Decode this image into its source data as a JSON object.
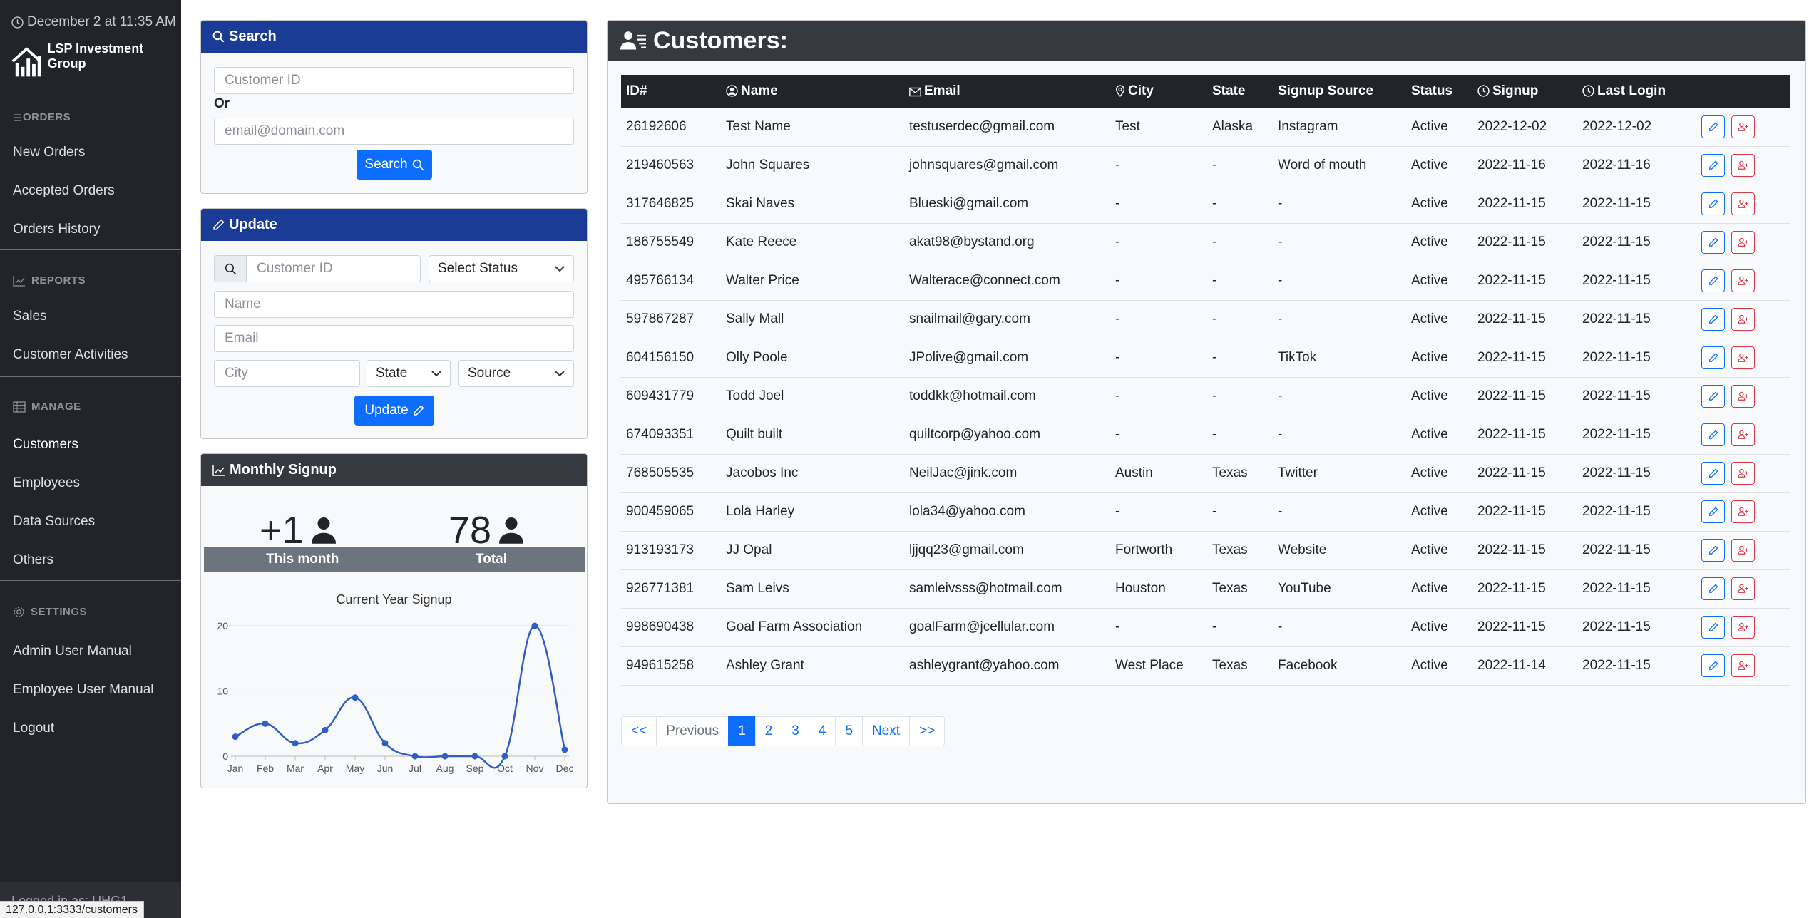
{
  "sidebar": {
    "datetime": "December 2 at 11:35 AM",
    "brand": "LSP Investment Group",
    "sections": {
      "orders": "ORDERS",
      "reports": "REPORTS",
      "manage": "MANAGE",
      "settings": "SETTINGS"
    },
    "items": {
      "new_orders": "New Orders",
      "accepted_orders": "Accepted Orders",
      "orders_history": "Orders History",
      "sales": "Sales",
      "customer_activities": "Customer Activities",
      "customers": "Customers",
      "employees": "Employees",
      "data_sources": "Data Sources",
      "others": "Others",
      "admin_manual": "Admin User Manual",
      "employee_manual": "Employee User Manual",
      "logout": "Logout"
    },
    "footer": "Logged in as: UHG1"
  },
  "status_url": "127.0.0.1:3333/customers",
  "search_card": {
    "title": "Search",
    "customer_id_placeholder": "Customer ID",
    "or_label": "Or",
    "email_placeholder": "email@domain.com",
    "button": "Search"
  },
  "update_card": {
    "title": "Update",
    "customer_id_placeholder": "Customer ID",
    "status_select": "Select Status",
    "name_placeholder": "Name",
    "email_placeholder": "Email",
    "city_placeholder": "City",
    "state_select": "State",
    "source_select": "Source",
    "button": "Update"
  },
  "signup_card": {
    "title": "Monthly Signup",
    "this_month_value": "+1",
    "total_value": "78",
    "this_month_label": "This month",
    "total_label": "Total"
  },
  "chart_data": {
    "type": "line",
    "title": "Current Year Signup",
    "categories": [
      "Jan",
      "Feb",
      "Mar",
      "Apr",
      "May",
      "Jun",
      "Jul",
      "Aug",
      "Sep",
      "Oct",
      "Nov",
      "Dec"
    ],
    "values": [
      3,
      5,
      2,
      4,
      9,
      2,
      0,
      0,
      0,
      0,
      20,
      1
    ],
    "ylim": [
      0,
      21
    ],
    "yticks": [
      0,
      10,
      20
    ],
    "xlabel": "",
    "ylabel": "",
    "grid": true,
    "smooth": true,
    "line_color": "#2f5ec4"
  },
  "customers": {
    "title": "Customers:",
    "columns": [
      "ID#",
      "Name",
      "Email",
      "City",
      "State",
      "Signup Source",
      "Status",
      "Signup",
      "Last Login"
    ],
    "rows": [
      [
        "26192606",
        "Test Name",
        "testuserdec@gmail.com",
        "Test",
        "Alaska",
        "Instagram",
        "Active",
        "2022-12-02",
        "2022-12-02"
      ],
      [
        "219460563",
        "John Squares",
        "johnsquares@gmail.com",
        "-",
        "-",
        "Word of mouth",
        "Active",
        "2022-11-16",
        "2022-11-16"
      ],
      [
        "317646825",
        "Skai Naves",
        "Blueski@gmail.com",
        "-",
        "-",
        "-",
        "Active",
        "2022-11-15",
        "2022-11-15"
      ],
      [
        "186755549",
        "Kate Reece",
        "akat98@bystand.org",
        "-",
        "-",
        "-",
        "Active",
        "2022-11-15",
        "2022-11-15"
      ],
      [
        "495766134",
        "Walter Price",
        "Walterace@connect.com",
        "-",
        "-",
        "-",
        "Active",
        "2022-11-15",
        "2022-11-15"
      ],
      [
        "597867287",
        "Sally Mall",
        "snailmail@gary.com",
        "-",
        "-",
        "-",
        "Active",
        "2022-11-15",
        "2022-11-15"
      ],
      [
        "604156150",
        "Olly Poole",
        "JPolive@gmail.com",
        "-",
        "-",
        "TikTok",
        "Active",
        "2022-11-15",
        "2022-11-15"
      ],
      [
        "609431779",
        "Todd Joel",
        "toddkk@hotmail.com",
        "-",
        "-",
        "-",
        "Active",
        "2022-11-15",
        "2022-11-15"
      ],
      [
        "674093351",
        "Quilt built",
        "quiltcorp@yahoo.com",
        "-",
        "-",
        "-",
        "Active",
        "2022-11-15",
        "2022-11-15"
      ],
      [
        "768505535",
        "Jacobos Inc",
        "NeilJac@jink.com",
        "Austin",
        "Texas",
        "Twitter",
        "Active",
        "2022-11-15",
        "2022-11-15"
      ],
      [
        "900459065",
        "Lola Harley",
        "lola34@yahoo.com",
        "-",
        "-",
        "-",
        "Active",
        "2022-11-15",
        "2022-11-15"
      ],
      [
        "913193173",
        "JJ Opal",
        "ljjqq23@gmail.com",
        "Fortworth",
        "Texas",
        "Website",
        "Active",
        "2022-11-15",
        "2022-11-15"
      ],
      [
        "926771381",
        "Sam Leivs",
        "samleivsss@hotmail.com",
        "Houston",
        "Texas",
        "YouTube",
        "Active",
        "2022-11-15",
        "2022-11-15"
      ],
      [
        "998690438",
        "Goal Farm Association",
        "goalFarm@jcellular.com",
        "-",
        "-",
        "-",
        "Active",
        "2022-11-15",
        "2022-11-15"
      ],
      [
        "949615258",
        "Ashley Grant",
        "ashleygrant@yahoo.com",
        "West Place",
        "Texas",
        "Facebook",
        "Active",
        "2022-11-14",
        "2022-11-15"
      ]
    ]
  },
  "pagination": {
    "first": "<<",
    "previous": "Previous",
    "pages": [
      "1",
      "2",
      "3",
      "4",
      "5"
    ],
    "active_page": "1",
    "next": "Next",
    "last": ">>"
  },
  "colors": {
    "sidebar_bg": "#212529",
    "card_header_blue": "#1b3c96",
    "primary": "#0d6efd",
    "danger": "#dc3545"
  },
  "icons": [
    "clock-icon",
    "logo-icon",
    "menu-icon",
    "chart-line-icon",
    "table-icon",
    "gear-icon",
    "search-icon",
    "pencil-icon",
    "person-icon",
    "customers-icon",
    "user-circle-icon",
    "envelope-icon",
    "geo-icon",
    "person-plus-icon"
  ]
}
